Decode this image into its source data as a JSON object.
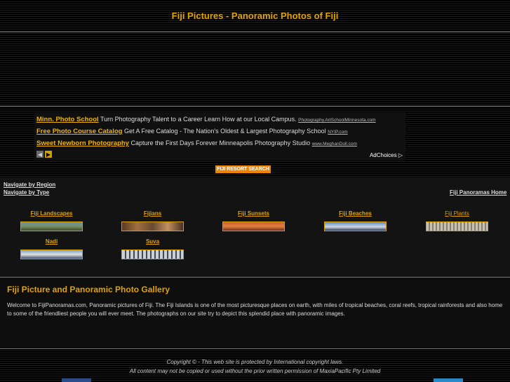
{
  "header": {
    "title": "Fiji Pictures - Panoramic Photos of Fiji"
  },
  "ads": {
    "items": [
      {
        "link": "Minn. Photo School",
        "text": " Turn Photography Talent to a Career Learn How at our Local Campus. ",
        "url": "Photography.ArtSchoolMinnesota.com"
      },
      {
        "link": "Free Photo Course Catalog",
        "text": " Get A Free Catalog - The Nation's Oldest & Largest Photography School ",
        "url": "NYIP.com"
      },
      {
        "link": "Sweet Newborn Photography",
        "text": " Capture the First Days Forever Minneapolis Photography Studio ",
        "url": "www.MeghanDoll.com"
      }
    ],
    "adchoices": "AdChoices ▷"
  },
  "resort_button": "FIJI RESORT SEARCH",
  "nav": {
    "by_region": "Navigate by Region",
    "by_type": "Navigate by Type",
    "home": "Fiji Panoramas Home"
  },
  "gallery": [
    {
      "label": "Fiji Landscapes"
    },
    {
      "label": "Fijians"
    },
    {
      "label": "Fiji Sunsets"
    },
    {
      "label": "Fiji Beaches"
    },
    {
      "label": "Fiji Plants"
    },
    {
      "label": "Nadi"
    },
    {
      "label": "Suva"
    }
  ],
  "about": {
    "title": "Fiji Picture and Panoramic Photo Gallery",
    "text": "Welcome to FijiPanoramas.com, Panoramic pictures of Fiji. The Fiji Islands is one of the most picturesque places on earth, with miles of tropical beaches, coral reefs, tropical rainforests and also home to some of the friendliest people you will ever meet. The photographs on our site try to depict this splendid place with panoramic images."
  },
  "footer": {
    "line1": "Copyright © - This web site is protected by International copyright laws.",
    "line2": "All content may not be copied or used without the prior written permission of MaxiaPacific Pty Limited"
  },
  "colors": {
    "accent": "#e0a300",
    "button": "#f08400",
    "border": "#8a7a2a"
  }
}
